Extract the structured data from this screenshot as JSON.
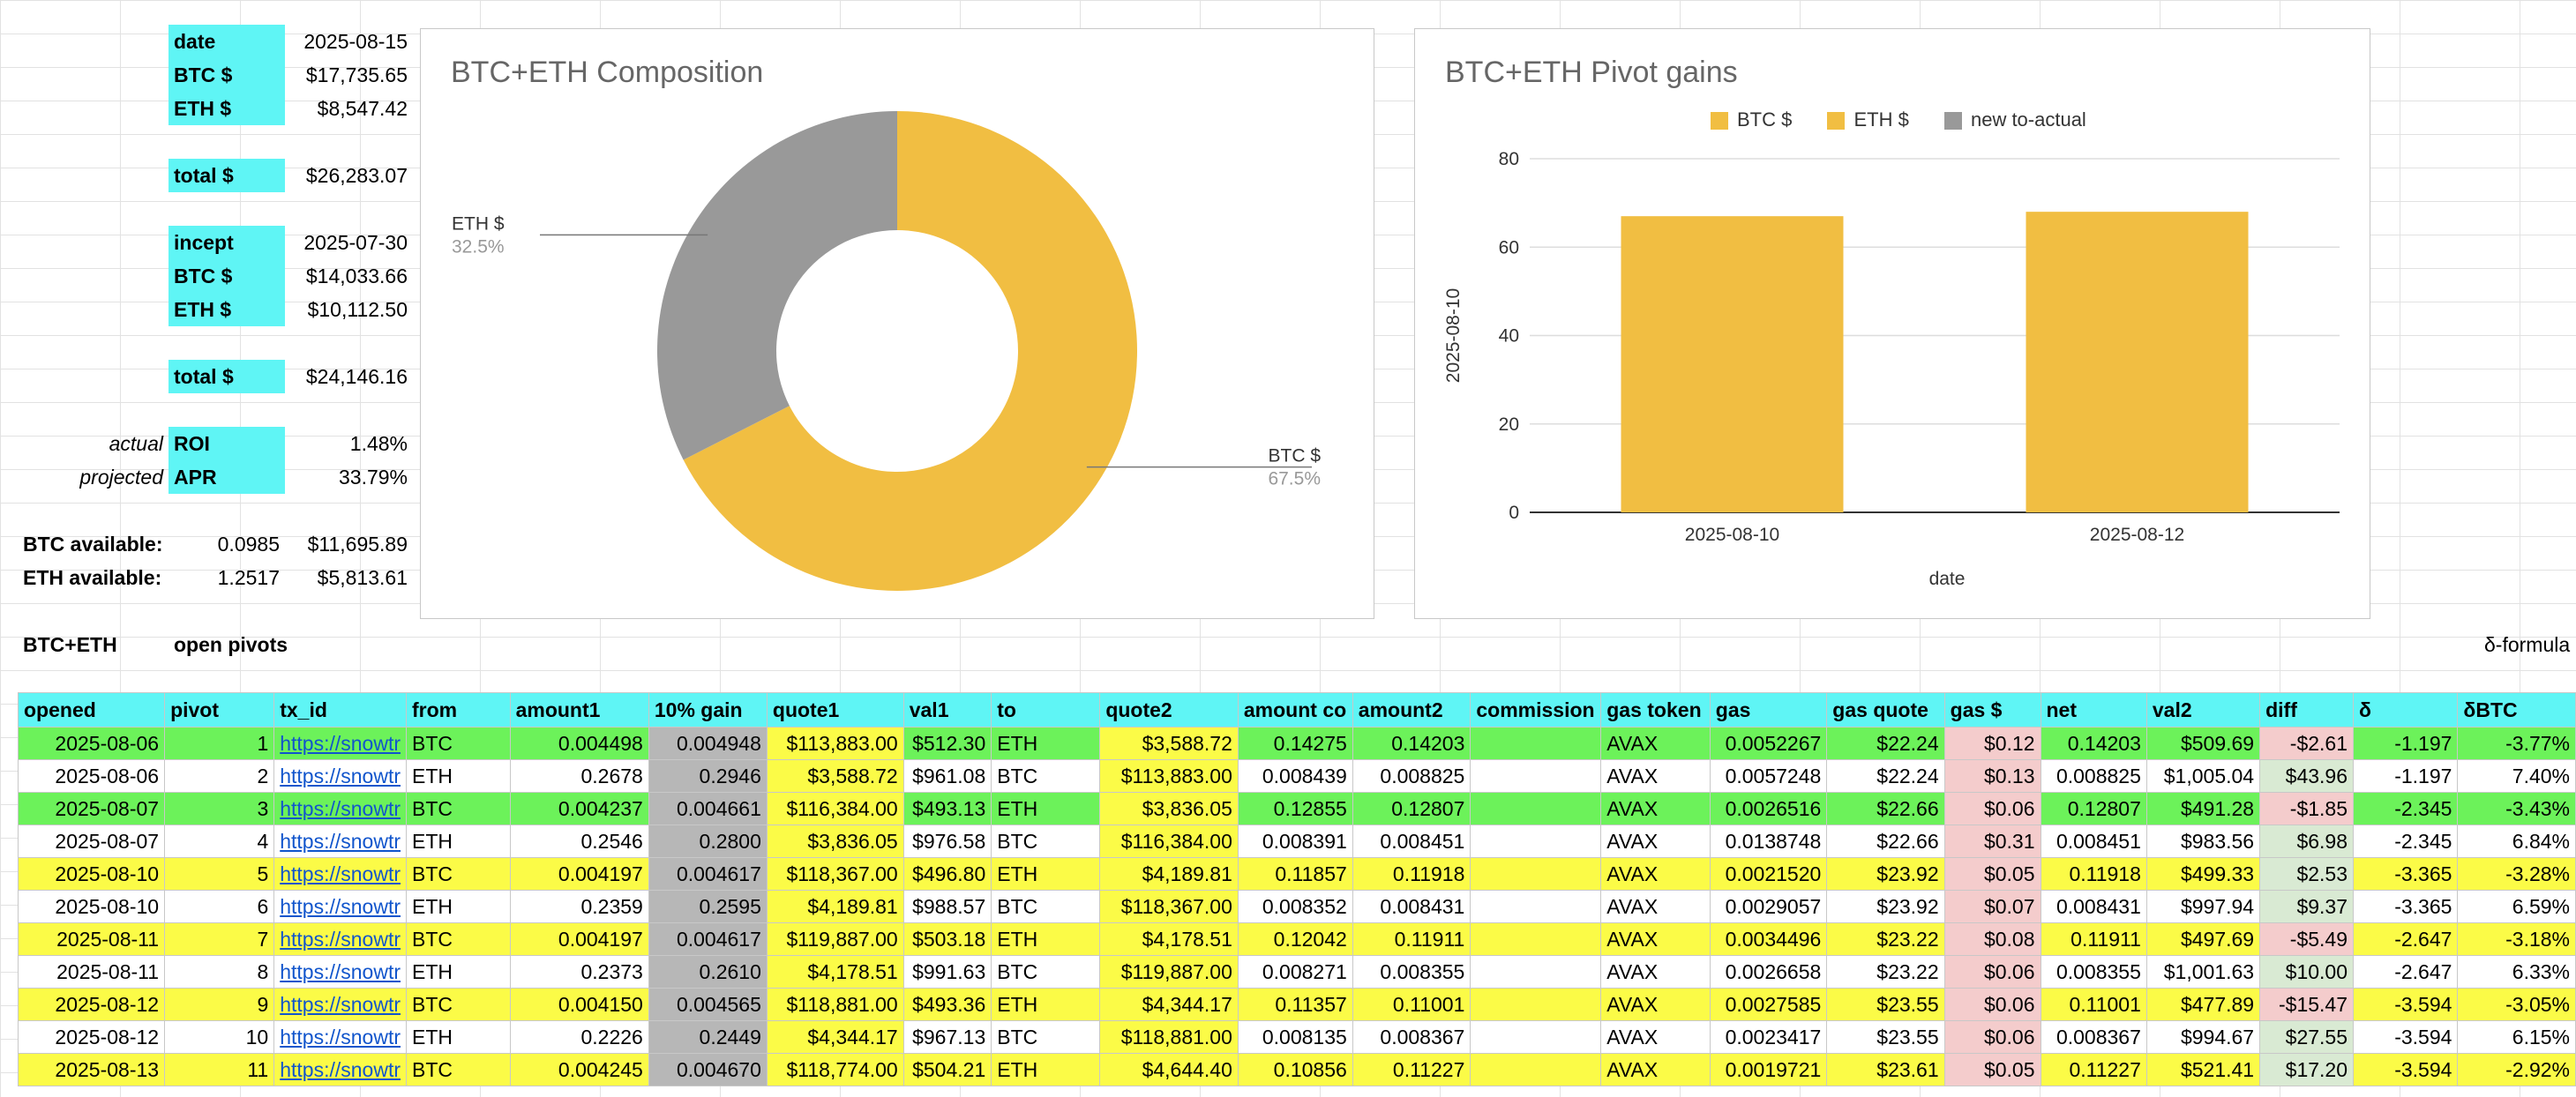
{
  "summary": {
    "date_label": "date",
    "date_value": "2025-08-15",
    "btc_label": "BTC $",
    "btc_value": "$17,735.65",
    "eth_label": "ETH $",
    "eth_value": "$8,547.42",
    "total_label": "total $",
    "total_value": "$26,283.07",
    "incept_label": "incept",
    "incept_value": "2025-07-30",
    "btc2_label": "BTC $",
    "btc2_value": "$14,033.66",
    "eth2_label": "ETH $",
    "eth2_value": "$10,112.50",
    "total2_label": "total $",
    "total2_value": "$24,146.16",
    "actual_label": "actual",
    "roi_label": "ROI",
    "roi_value": "1.48%",
    "projected_label": "projected",
    "apr_label": "APR",
    "apr_value": "33.79%",
    "btc_avail_label": "BTC available:",
    "btc_avail_qty": "0.0985",
    "btc_avail_usd": "$11,695.89",
    "eth_avail_label": "ETH available:",
    "eth_avail_qty": "1.2517",
    "eth_avail_usd": "$5,813.61",
    "section_label": "BTC+ETH",
    "open_pivots_label": "open pivots",
    "delta_formula_label": "δ-formula"
  },
  "chart_data": [
    {
      "type": "pie",
      "title": "BTC+ETH Composition",
      "donut": true,
      "slices": [
        {
          "label": "BTC $",
          "value": 67.5,
          "pct_label": "67.5%",
          "color": "#f1be42"
        },
        {
          "label": "ETH $",
          "value": 32.5,
          "pct_label": "32.5%",
          "color": "#999999"
        }
      ]
    },
    {
      "type": "bar",
      "title": "BTC+ETH Pivot gains",
      "legend": [
        "BTC $",
        "ETH $",
        "new to-actual"
      ],
      "legend_colors": [
        "#f1be42",
        "#f1be42",
        "#999999"
      ],
      "legend_position": "top",
      "categories": [
        "2025-08-10",
        "2025-08-12"
      ],
      "series": [
        {
          "name": "BTC $",
          "values": [
            67,
            68
          ]
        }
      ],
      "xlabel": "date",
      "ylabel": "2025-08-10",
      "ylim": [
        0,
        80
      ],
      "yticks": [
        "0",
        "20",
        "40",
        "60",
        "80"
      ],
      "grid": true
    }
  ],
  "table": {
    "headers": [
      "opened",
      "pivot",
      "tx_id",
      "from",
      "amount1",
      "10% gain",
      "quote1",
      "val1",
      "to",
      "quote2",
      "amount co",
      "amount2",
      "commission",
      "gas token",
      "gas",
      "gas quote",
      "gas $",
      "net",
      "val2",
      "diff",
      "δ",
      "δBTC"
    ],
    "rows": [
      {
        "style": "green",
        "cells": [
          "2025-08-06",
          "1",
          "https://snowtr",
          "BTC",
          "0.004498",
          "0.004948",
          "$113,883.00",
          "$512.30",
          "ETH",
          "$3,588.72",
          "0.14275",
          "0.14203",
          "",
          "AVAX",
          "0.0052267",
          "$22.24",
          "$0.12",
          "0.14203",
          "$509.69",
          "-$2.61",
          "-1.197",
          "-3.77%"
        ]
      },
      {
        "style": "white",
        "cells": [
          "2025-08-06",
          "2",
          "https://snowtr",
          "ETH",
          "0.2678",
          "0.2946",
          "$3,588.72",
          "$961.08",
          "BTC",
          "$113,883.00",
          "0.008439",
          "0.008825",
          "",
          "AVAX",
          "0.0057248",
          "$22.24",
          "$0.13",
          "0.008825",
          "$1,005.04",
          "$43.96",
          "-1.197",
          "7.40%"
        ]
      },
      {
        "style": "green",
        "cells": [
          "2025-08-07",
          "3",
          "https://snowtr",
          "BTC",
          "0.004237",
          "0.004661",
          "$116,384.00",
          "$493.13",
          "ETH",
          "$3,836.05",
          "0.12855",
          "0.12807",
          "",
          "AVAX",
          "0.0026516",
          "$22.66",
          "$0.06",
          "0.12807",
          "$491.28",
          "-$1.85",
          "-2.345",
          "-3.43%"
        ]
      },
      {
        "style": "white",
        "cells": [
          "2025-08-07",
          "4",
          "https://snowtr",
          "ETH",
          "0.2546",
          "0.2800",
          "$3,836.05",
          "$976.58",
          "BTC",
          "$116,384.00",
          "0.008391",
          "0.008451",
          "",
          "AVAX",
          "0.0138748",
          "$22.66",
          "$0.31",
          "0.008451",
          "$983.56",
          "$6.98",
          "-2.345",
          "6.84%"
        ]
      },
      {
        "style": "yellow",
        "cells": [
          "2025-08-10",
          "5",
          "https://snowtr",
          "BTC",
          "0.004197",
          "0.004617",
          "$118,367.00",
          "$496.80",
          "ETH",
          "$4,189.81",
          "0.11857",
          "0.11918",
          "",
          "AVAX",
          "0.0021520",
          "$23.92",
          "$0.05",
          "0.11918",
          "$499.33",
          "$2.53",
          "-3.365",
          "-3.28%"
        ]
      },
      {
        "style": "white",
        "cells": [
          "2025-08-10",
          "6",
          "https://snowtr",
          "ETH",
          "0.2359",
          "0.2595",
          "$4,189.81",
          "$988.57",
          "BTC",
          "$118,367.00",
          "0.008352",
          "0.008431",
          "",
          "AVAX",
          "0.0029057",
          "$23.92",
          "$0.07",
          "0.008431",
          "$997.94",
          "$9.37",
          "-3.365",
          "6.59%"
        ]
      },
      {
        "style": "yellow",
        "cells": [
          "2025-08-11",
          "7",
          "https://snowtr",
          "BTC",
          "0.004197",
          "0.004617",
          "$119,887.00",
          "$503.18",
          "ETH",
          "$4,178.51",
          "0.12042",
          "0.11911",
          "",
          "AVAX",
          "0.0034496",
          "$23.22",
          "$0.08",
          "0.11911",
          "$497.69",
          "-$5.49",
          "-2.647",
          "-3.18%"
        ]
      },
      {
        "style": "white",
        "cells": [
          "2025-08-11",
          "8",
          "https://snowtr",
          "ETH",
          "0.2373",
          "0.2610",
          "$4,178.51",
          "$991.63",
          "BTC",
          "$119,887.00",
          "0.008271",
          "0.008355",
          "",
          "AVAX",
          "0.0026658",
          "$23.22",
          "$0.06",
          "0.008355",
          "$1,001.63",
          "$10.00",
          "-2.647",
          "6.33%"
        ]
      },
      {
        "style": "yellow",
        "cells": [
          "2025-08-12",
          "9",
          "https://snowtr",
          "BTC",
          "0.004150",
          "0.004565",
          "$118,881.00",
          "$493.36",
          "ETH",
          "$4,344.17",
          "0.11357",
          "0.11001",
          "",
          "AVAX",
          "0.0027585",
          "$23.55",
          "$0.06",
          "0.11001",
          "$477.89",
          "-$15.47",
          "-3.594",
          "-3.05%"
        ]
      },
      {
        "style": "white",
        "cells": [
          "2025-08-12",
          "10",
          "https://snowtr",
          "ETH",
          "0.2226",
          "0.2449",
          "$4,344.17",
          "$967.13",
          "BTC",
          "$118,881.00",
          "0.008135",
          "0.008367",
          "",
          "AVAX",
          "0.0023417",
          "$23.55",
          "$0.06",
          "0.008367",
          "$994.67",
          "$27.55",
          "-3.594",
          "6.15%"
        ]
      },
      {
        "style": "yellow",
        "cells": [
          "2025-08-13",
          "11",
          "https://snowtr",
          "BTC",
          "0.004245",
          "0.004670",
          "$118,774.00",
          "$504.21",
          "ETH",
          "$4,644.40",
          "0.10856",
          "0.11227",
          "",
          "AVAX",
          "0.0019721",
          "$23.61",
          "$0.05",
          "0.11227",
          "$521.41",
          "$17.20",
          "-3.594",
          "-2.92%"
        ]
      }
    ]
  }
}
